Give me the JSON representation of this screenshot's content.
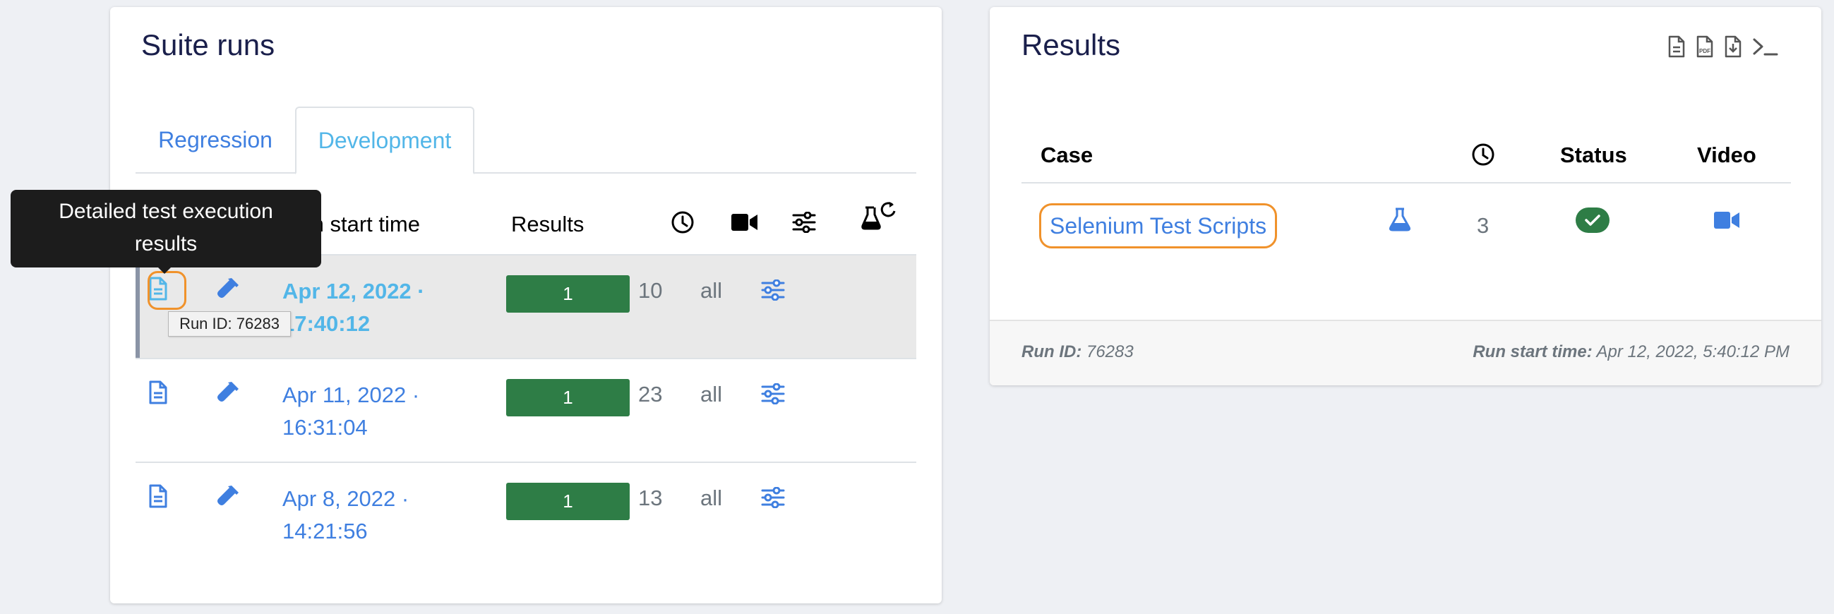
{
  "suite": {
    "title": "Suite runs",
    "tabs": [
      {
        "label": "Regression"
      },
      {
        "label": "Development"
      }
    ],
    "headers": {
      "run_start_time": "Run start time",
      "results": "Results"
    },
    "rows": [
      {
        "date": "Apr 12, 2022 ·",
        "time": "17:40:12",
        "result": "1",
        "duration": "10",
        "video": "all"
      },
      {
        "date": "Apr 11, 2022 ·",
        "time": "16:31:04",
        "result": "1",
        "duration": "23",
        "video": "all"
      },
      {
        "date": "Apr 8, 2022 ·",
        "time": "14:21:56",
        "result": "1",
        "duration": "13",
        "video": "all"
      }
    ],
    "tooltip": {
      "line1": "Detailed test execution",
      "line2": "results"
    },
    "small_tip": "Run ID: 76283"
  },
  "results": {
    "title": "Results",
    "headers": {
      "case": "Case",
      "status": "Status",
      "video": "Video"
    },
    "row": {
      "case": "Selenium Test Scripts",
      "duration": "3"
    },
    "footer": {
      "run_id_label": "Run ID:",
      "run_id": "76283",
      "run_start_label": "Run start time:",
      "run_start": "Apr 12, 2022, 5:40:12 PM"
    }
  },
  "colors": {
    "link": "#3f7fe0",
    "active_tab": "#52b6e8",
    "success": "#2e7d46",
    "highlight": "#f0922b"
  }
}
